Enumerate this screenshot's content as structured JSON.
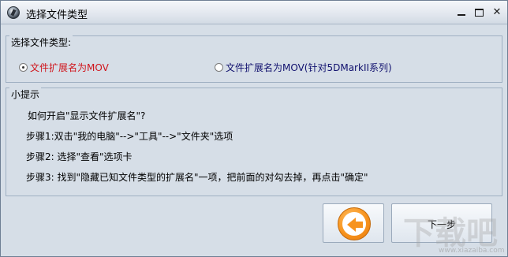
{
  "window": {
    "title": "选择文件类型",
    "controls": {
      "minimize": "",
      "maximize": "",
      "close": "✕"
    }
  },
  "file_type_group": {
    "label": "选择文件类型:",
    "options": [
      {
        "label": "文件扩展名为MOV",
        "selected": true,
        "color": "#d0141b"
      },
      {
        "label": "文件扩展名为MOV(针对5DMarkII系列)",
        "selected": false,
        "color": "#10106e"
      }
    ]
  },
  "tips_group": {
    "label": "小提示",
    "lines": [
      "如何开启\"显示文件扩展名\"?",
      "步骤1:双击\"我的电脑\"-->\"工具\"-->\"文件夹\"选项",
      "步骤2: 选择\"查看\"选项卡",
      "步骤3: 找到\"隐藏已知文件类型的扩展名\"一项，把前面的对勾去掉，再点击\"确定\""
    ]
  },
  "buttons": {
    "back_icon": "left-arrow-icon",
    "next_label": "下一步"
  },
  "watermark": {
    "text": "下载吧",
    "url": "www.xiazaiba.com"
  },
  "colors": {
    "accent": "#f7931e",
    "window_bg": "#d6dee7"
  }
}
